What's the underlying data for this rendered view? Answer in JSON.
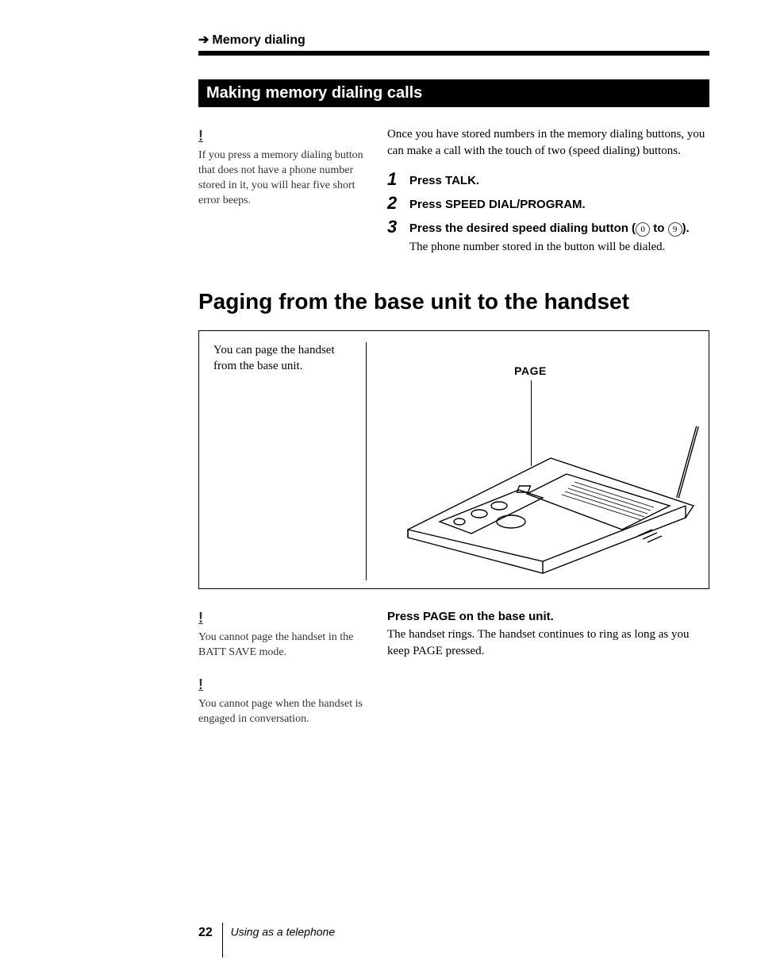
{
  "breadcrumb": "Memory dialing",
  "section_bar": "Making memory dialing calls",
  "sidenote1": {
    "mark": "!",
    "text": "If you press a memory dialing button that does not have a phone number stored in it, you will hear five short error beeps."
  },
  "intro": "Once you have stored numbers in the memory dialing buttons, you can make a call with the touch of two (speed dialing) buttons.",
  "steps": [
    {
      "num": "1",
      "title": "Press TALK.",
      "detail": ""
    },
    {
      "num": "2",
      "title": "Press SPEED DIAL/PROGRAM.",
      "detail": ""
    },
    {
      "num": "3",
      "title_pre": "Press the desired speed dialing button (",
      "circ1": "0",
      "title_mid": " to ",
      "circ2": "9",
      "title_post": ").",
      "detail": "The phone number stored in the button will be dialed."
    }
  ],
  "heading2": "Paging from the base unit to the handset",
  "figure": {
    "caption": "You can page the handset from the base unit.",
    "label": "PAGE"
  },
  "sidenote2": {
    "mark": "!",
    "text": "You cannot page the handset in the BATT SAVE mode."
  },
  "sidenote3": {
    "mark": "!",
    "text": "You cannot page when the handset is engaged in conversation."
  },
  "instruction2": {
    "title": "Press PAGE on the base unit.",
    "detail": "The handset rings. The handset continues to ring as long as you keep PAGE pressed."
  },
  "footer": {
    "page": "22",
    "section": "Using as a telephone"
  }
}
